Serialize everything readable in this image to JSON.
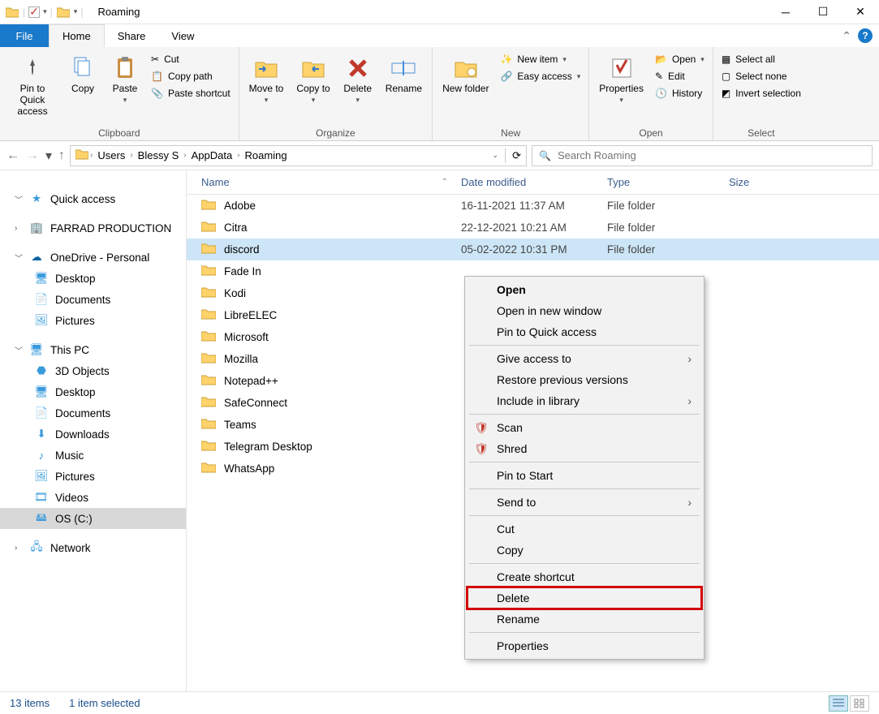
{
  "window": {
    "title": "Roaming"
  },
  "tabs": {
    "file": "File",
    "home": "Home",
    "share": "Share",
    "view": "View"
  },
  "ribbon": {
    "clipboard": {
      "label": "Clipboard",
      "pin": "Pin to Quick access",
      "copy": "Copy",
      "paste": "Paste",
      "cut": "Cut",
      "copypath": "Copy path",
      "pasteshortcut": "Paste shortcut"
    },
    "organize": {
      "label": "Organize",
      "moveto": "Move to",
      "copyto": "Copy to",
      "delete": "Delete",
      "rename": "Rename"
    },
    "new": {
      "label": "New",
      "newfolder": "New folder",
      "newitem": "New item",
      "easyaccess": "Easy access"
    },
    "open": {
      "label": "Open",
      "properties": "Properties",
      "open": "Open",
      "edit": "Edit",
      "history": "History"
    },
    "select": {
      "label": "Select",
      "all": "Select all",
      "none": "Select none",
      "invert": "Invert selection"
    }
  },
  "breadcrumb": [
    "Users",
    "Blessy S",
    "AppData",
    "Roaming"
  ],
  "search": {
    "placeholder": "Search Roaming"
  },
  "columns": {
    "name": "Name",
    "date": "Date modified",
    "type": "Type",
    "size": "Size"
  },
  "sidebar": {
    "quick": "Quick access",
    "farrad": "FARRAD PRODUCTION",
    "onedrive": "OneDrive - Personal",
    "od_items": [
      "Desktop",
      "Documents",
      "Pictures"
    ],
    "thispc": "This PC",
    "pc_items": [
      "3D Objects",
      "Desktop",
      "Documents",
      "Downloads",
      "Music",
      "Pictures",
      "Videos",
      "OS (C:)"
    ],
    "network": "Network"
  },
  "files": [
    {
      "name": "Adobe",
      "date": "16-11-2021 11:37 AM",
      "type": "File folder"
    },
    {
      "name": "Citra",
      "date": "22-12-2021 10:21 AM",
      "type": "File folder"
    },
    {
      "name": "discord",
      "date": "05-02-2022 10:31 PM",
      "type": "File folder",
      "selected": true
    },
    {
      "name": "Fade In",
      "date": "",
      "type": ""
    },
    {
      "name": "Kodi",
      "date": "",
      "type": ""
    },
    {
      "name": "LibreELEC",
      "date": "",
      "type": ""
    },
    {
      "name": "Microsoft",
      "date": "",
      "type": ""
    },
    {
      "name": "Mozilla",
      "date": "",
      "type": ""
    },
    {
      "name": "Notepad++",
      "date": "",
      "type": ""
    },
    {
      "name": "SafeConnect",
      "date": "",
      "type": ""
    },
    {
      "name": "Teams",
      "date": "",
      "type": ""
    },
    {
      "name": "Telegram Desktop",
      "date": "",
      "type": ""
    },
    {
      "name": "WhatsApp",
      "date": "",
      "type": ""
    }
  ],
  "status": {
    "count": "13 items",
    "selected": "1 item selected"
  },
  "ctx": {
    "open": "Open",
    "openwin": "Open in new window",
    "pinquick": "Pin to Quick access",
    "give": "Give access to",
    "restore": "Restore previous versions",
    "include": "Include in library",
    "scan": "Scan",
    "shred": "Shred",
    "pinstart": "Pin to Start",
    "sendto": "Send to",
    "cut": "Cut",
    "copy": "Copy",
    "shortcut": "Create shortcut",
    "delete": "Delete",
    "rename": "Rename",
    "props": "Properties"
  }
}
